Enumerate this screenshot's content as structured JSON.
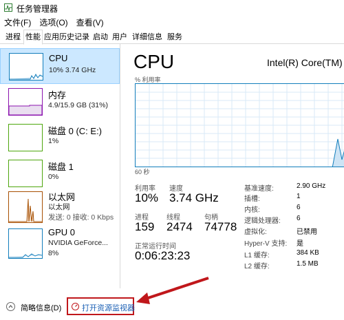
{
  "window": {
    "title": "任务管理器"
  },
  "menu": [
    "文件(F)",
    "选项(O)",
    "查看(V)"
  ],
  "tabs": [
    "进程",
    "性能",
    "应用历史记录",
    "启动",
    "用户",
    "详细信息",
    "服务"
  ],
  "sidebar": {
    "items": [
      {
        "name": "CPU",
        "sub1": "10% 3.74 GHz",
        "sub2": "",
        "color": "#117dbb"
      },
      {
        "name": "内存",
        "sub1": "4.9/15.9 GB (31%)",
        "sub2": "",
        "color": "#8b12ae"
      },
      {
        "name": "磁盘 0 (C: E:)",
        "sub1": "1%",
        "sub2": "",
        "color": "#4da60c"
      },
      {
        "name": "磁盘 1",
        "sub1": "0%",
        "sub2": "",
        "color": "#4da60c"
      },
      {
        "name": "以太网",
        "sub1": "以太网",
        "sub2": "发送: 0 接收: 0 Kbps",
        "color": "#a74f01"
      },
      {
        "name": "GPU 0",
        "sub1": "NVIDIA GeForce...",
        "sub2": "8%",
        "color": "#117dbb"
      }
    ]
  },
  "main": {
    "title": "CPU",
    "model": "Intel(R) Core(TM) i",
    "util_label": "% 利用率",
    "time_label": "60 秒",
    "stats": {
      "util_label": "利用率",
      "util_value": "10%",
      "speed_label": "速度",
      "speed_value": "3.74 GHz",
      "proc_label": "进程",
      "proc_value": "159",
      "thread_label": "线程",
      "thread_value": "2474",
      "handle_label": "句柄",
      "handle_value": "74778",
      "uptime_label": "正常运行时间",
      "uptime_value": "0:06:23:23"
    },
    "specs": [
      {
        "label": "基准速度:",
        "value": "2.90 GHz"
      },
      {
        "label": "插槽:",
        "value": "1"
      },
      {
        "label": "内核:",
        "value": "6"
      },
      {
        "label": "逻辑处理器:",
        "value": "6"
      },
      {
        "label": "虚拟化:",
        "value": "已禁用"
      },
      {
        "label": "Hyper-V 支持:",
        "value": "是"
      },
      {
        "label": "L1 缓存:",
        "value": "384 KB"
      },
      {
        "label": "L2 缓存:",
        "value": "1.5 MB"
      }
    ]
  },
  "bottom": {
    "fewer_details": "简略信息(D)",
    "open_monitor": "打开资源监视器"
  },
  "colors": {
    "cpu": "#117dbb",
    "highlight": "#c0171b"
  }
}
